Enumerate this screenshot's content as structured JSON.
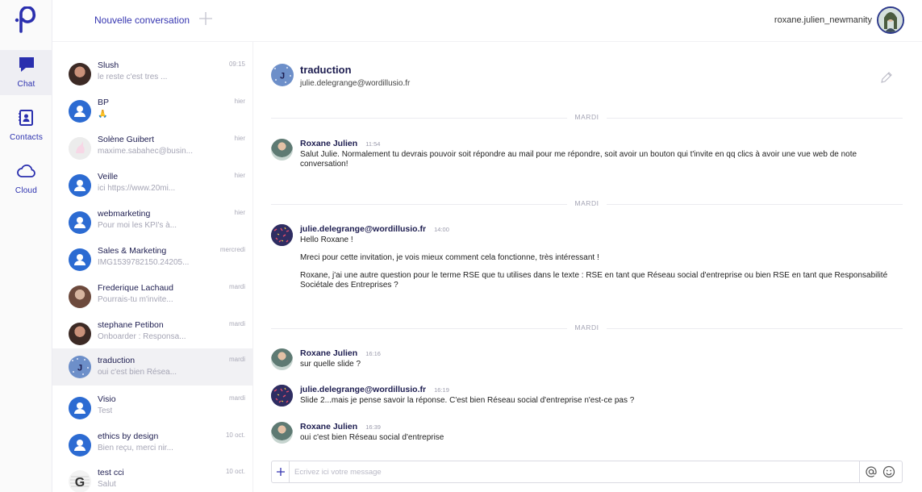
{
  "rail": {
    "items": [
      {
        "label": "Chat",
        "icon": "chat-icon",
        "active": true
      },
      {
        "label": "Contacts",
        "icon": "contacts-icon",
        "active": false
      },
      {
        "label": "Cloud",
        "icon": "cloud-icon",
        "active": false
      }
    ]
  },
  "topbar": {
    "new_conversation_label": "Nouvelle conversation",
    "username": "roxane.julien_newmanity"
  },
  "conversations": [
    {
      "name": "Slush",
      "preview": "le reste c'est tres ...",
      "time": "09:15"
    },
    {
      "name": "BP",
      "preview": "🙏",
      "time": "hier"
    },
    {
      "name": "Solène Guibert",
      "preview": "maxime.sabahec@busin...",
      "time": "hier"
    },
    {
      "name": "Veille",
      "preview": "ici https://www.20mi...",
      "time": "hier"
    },
    {
      "name": "webmarketing",
      "preview": "Pour moi les KPI's à...",
      "time": "hier"
    },
    {
      "name": "Sales & Marketing",
      "preview": "IMG1539782150.24205...",
      "time": "mercredi"
    },
    {
      "name": "Frederique Lachaud",
      "preview": "Pourrais-tu m'invite...",
      "time": "mardi"
    },
    {
      "name": "stephane Petibon",
      "preview": "Onboarder : Responsa...",
      "time": "mardi"
    },
    {
      "name": "traduction",
      "preview": "oui c'est bien Résea...",
      "time": "mardi",
      "selected": true
    },
    {
      "name": "Visio",
      "preview": "Test",
      "time": "mardi"
    },
    {
      "name": "ethics by design",
      "preview": "Bien reçu, merci nir...",
      "time": "10 oct."
    },
    {
      "name": "test cci",
      "preview": "Salut",
      "time": "10 oct."
    }
  ],
  "chat": {
    "title": "traduction",
    "avatar_letter": "J",
    "email": "julie.delegrange@wordillusio.fr",
    "day_labels": [
      "MARDI",
      "MARDI",
      "MARDI"
    ],
    "messages": [
      {
        "author": "Roxane Julien",
        "time": "11:54",
        "lines": [
          "Salut Julie. Normalement tu devrais pouvoir soit répondre au mail pour me répondre, soit avoir un bouton qui t'invite en qq clics à avoir une vue web de note conversation!"
        ]
      },
      {
        "author": "julie.delegrange@wordillusio.fr",
        "time": "14:00",
        "lines": [
          "Hello Roxane !",
          "Mreci pour cette invitation, je vois mieux comment cela fonctionne, très intéressant !",
          "Roxane, j'ai une autre question pour le terme RSE que tu utilises dans le texte : RSE en tant que Réseau social d'entreprise ou bien RSE en tant que Responsabilité Sociétale des Entreprises ?"
        ]
      },
      {
        "author": "Roxane Julien",
        "time": "16:16",
        "lines": [
          "sur quelle slide ?"
        ]
      },
      {
        "author": "julie.delegrange@wordillusio.fr",
        "time": "16:19",
        "lines": [
          "Slide 2...mais je pense savoir la réponse. C'est bien Réseau social d'entreprise n'est-ce pas ?"
        ]
      },
      {
        "author": "Roxane Julien",
        "time": "16:39",
        "lines": [
          "oui c'est bien Réseau social d'entreprise"
        ]
      }
    ]
  },
  "composer": {
    "placeholder": "Ecrivez ici votre message"
  },
  "colors": {
    "accent": "#3535b0",
    "navy": "#1d1d50",
    "avatar_blue": "#2c6bd2"
  }
}
